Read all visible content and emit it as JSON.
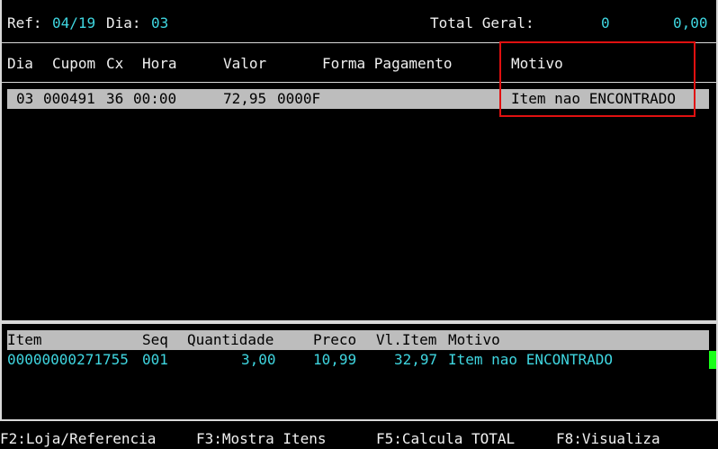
{
  "header": {
    "ref_label": "Ref:",
    "ref_value": "04/19",
    "dia_label": "Dia:",
    "dia_value": "03",
    "total_label": "Total Geral:",
    "total_count": "0",
    "total_value": "0,00"
  },
  "top_table": {
    "columns": {
      "dia": "Dia",
      "cupom": "Cupom",
      "cx": "Cx",
      "hora": "Hora",
      "valor": "Valor",
      "forma": "Forma Pagamento",
      "motivo": "Motivo"
    },
    "rows": [
      {
        "dia": "03",
        "cupom": "000491",
        "cx": "36",
        "hora": "00:00",
        "valor": "72,95",
        "forma": "0000F",
        "motivo": "Item nao ENCONTRADO"
      }
    ]
  },
  "bottom_table": {
    "columns": {
      "item": "Item",
      "seq": "Seq",
      "quantidade": "Quantidade",
      "preco": "Preco",
      "vl_item": "Vl.Item",
      "motivo": "Motivo"
    },
    "rows": [
      {
        "item": "00000000271755",
        "seq": "001",
        "quantidade": "3,00",
        "preco": "10,99",
        "vl_item": "32,97",
        "motivo": "Item nao ENCONTRADO"
      }
    ]
  },
  "function_keys": [
    {
      "label": "F2:Loja/Referencia"
    },
    {
      "label": "F3:Mostra Itens"
    },
    {
      "label": "F5:Calcula TOTAL"
    },
    {
      "label": "F8:Visualiza"
    }
  ],
  "colors": {
    "background": "#000000",
    "text": "#e8e8e8",
    "cyan": "#3fd6e0",
    "highlight": "#bdbdbd",
    "annotation": "#e01010",
    "cursor": "#19ff19"
  }
}
